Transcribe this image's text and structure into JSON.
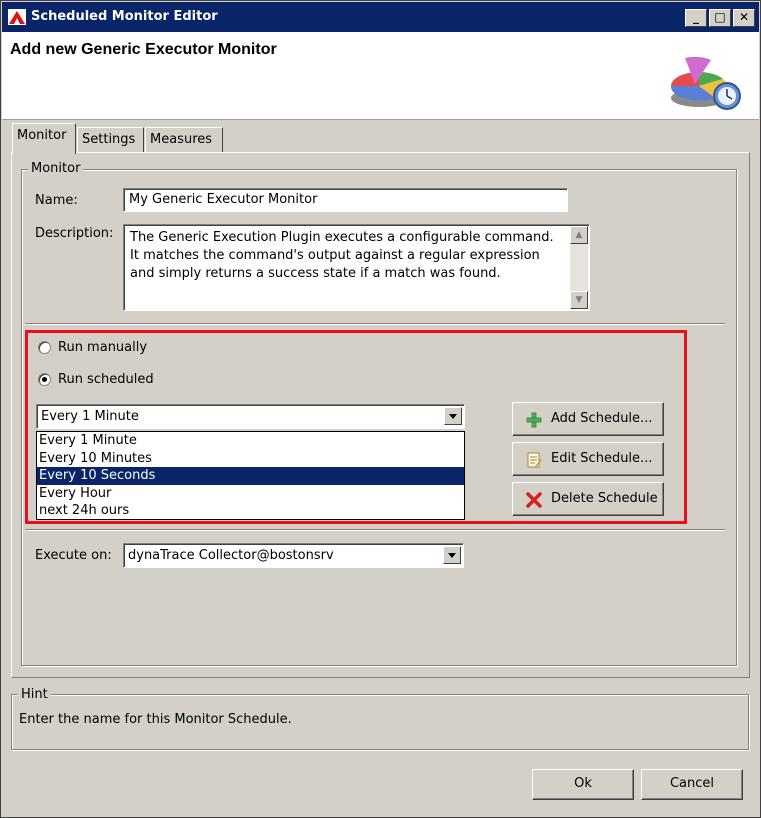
{
  "window": {
    "title": "Scheduled Monitor Editor",
    "minimize": "_",
    "maximize": "□",
    "close": "✕"
  },
  "header": {
    "title": "Add new Generic Executor Monitor"
  },
  "tabs": [
    {
      "label": "Monitor",
      "active": true
    },
    {
      "label": "Settings",
      "active": false
    },
    {
      "label": "Measures",
      "active": false
    }
  ],
  "monitor_group": {
    "legend": "Monitor",
    "name_label": "Name:",
    "name_value": "My Generic Executor Monitor",
    "description_label": "Description:",
    "description_value": "The Generic Execution Plugin executes a configurable command. It matches the command's output against a regular expression and simply returns a success state if a match was found."
  },
  "schedule": {
    "run_manually_label": "Run manually",
    "run_manually_checked": false,
    "run_scheduled_label": "Run scheduled",
    "run_scheduled_checked": true,
    "selected": "Every 1 Minute",
    "options": [
      "Every 1 Minute",
      "Every 10 Minutes",
      "Every 10 Seconds",
      "Every Hour",
      "next 24h ours"
    ],
    "highlighted_option": "Every 10 Seconds",
    "add_button": "Add Schedule...",
    "edit_button": "Edit Schedule...",
    "delete_button": "Delete Schedule"
  },
  "execute": {
    "label": "Execute on:",
    "value": "dynaTrace Collector@bostonsrv"
  },
  "hint": {
    "legend": "Hint",
    "text": "Enter the name for this Monitor Schedule."
  },
  "footer": {
    "ok": "Ok",
    "cancel": "Cancel"
  },
  "colors": {
    "title_bar": "#0a246a",
    "dialog_bg": "#d4d0c8",
    "highlight_border": "#e8101a",
    "list_selection": "#0a246a"
  }
}
